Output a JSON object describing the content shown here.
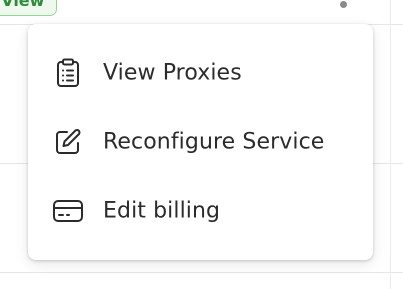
{
  "badge": {
    "label": "k View"
  },
  "menu": {
    "items": [
      {
        "label": "View Proxies",
        "icon": "clipboard-list-icon"
      },
      {
        "label": "Reconfigure Service",
        "icon": "edit-pencil-icon"
      },
      {
        "label": "Edit billing",
        "icon": "credit-card-icon"
      }
    ]
  },
  "colors": {
    "badge_text": "#2f8a3a",
    "badge_border": "#9ad39a",
    "menu_text": "#2b2b2b",
    "icon_stroke": "#2b2b2b"
  }
}
